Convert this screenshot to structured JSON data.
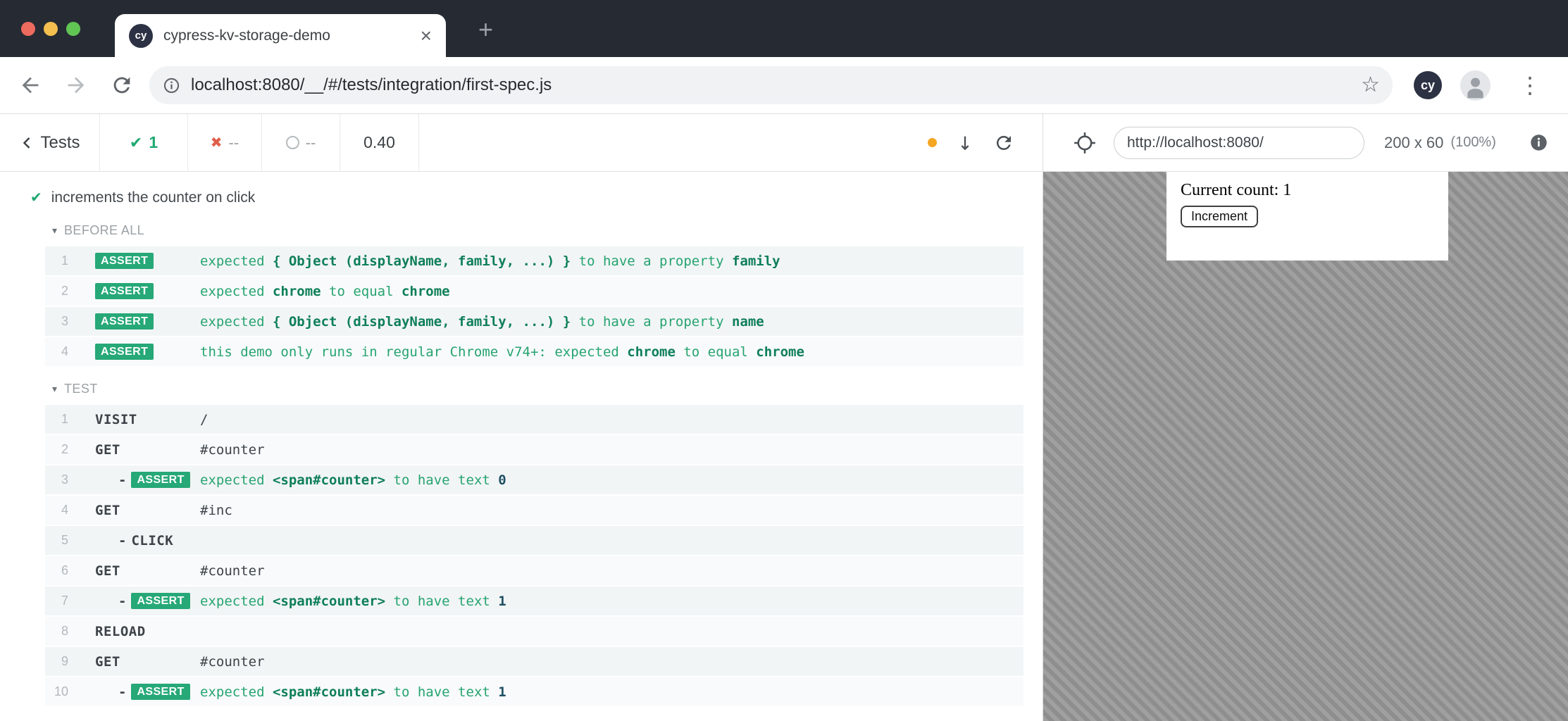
{
  "icons": {
    "check": "✔",
    "cross": "✖",
    "star": "☆",
    "menu_dots": "⋮",
    "close": "×",
    "plus": "+",
    "collapse_caret": "▾",
    "child_dash": "-"
  },
  "titlebar": {
    "tab_title": "cypress-kv-storage-demo",
    "favicon_text": "cy"
  },
  "navbar": {
    "url": "localhost:8080/__/#/tests/integration/first-spec.js",
    "profile_badge": "cy"
  },
  "cy_toolbar": {
    "back_label": "Tests",
    "passed_count": "1",
    "failed_count": "--",
    "pending_count": "--",
    "duration": "0.40",
    "viewport_url": "http://localhost:8080/",
    "viewport_size": "200 x 60",
    "viewport_scale": "(100%)"
  },
  "reporter": {
    "test_title": "increments the counter on click",
    "sections": [
      {
        "label": "BEFORE ALL",
        "rows": [
          {
            "num": "1",
            "badge": "ASSERT",
            "child": false,
            "msg": [
              [
                "expected ",
                "n"
              ],
              [
                "{ Object (displayName, family, ...) }",
                "b"
              ],
              [
                " to have a property ",
                "n"
              ],
              [
                "family",
                "b"
              ]
            ]
          },
          {
            "num": "2",
            "badge": "ASSERT",
            "child": false,
            "msg": [
              [
                "expected ",
                "n"
              ],
              [
                "chrome",
                "b"
              ],
              [
                " to equal ",
                "n"
              ],
              [
                "chrome",
                "b"
              ]
            ]
          },
          {
            "num": "3",
            "badge": "ASSERT",
            "child": false,
            "msg": [
              [
                "expected ",
                "n"
              ],
              [
                "{ Object (displayName, family, ...) }",
                "b"
              ],
              [
                " to have a property ",
                "n"
              ],
              [
                "name",
                "b"
              ]
            ]
          },
          {
            "num": "4",
            "badge": "ASSERT",
            "child": false,
            "msg": [
              [
                "this demo only runs in regular Chrome v74+: expected ",
                "n"
              ],
              [
                "chrome",
                "b"
              ],
              [
                " to equal ",
                "n"
              ],
              [
                "chrome",
                "b"
              ]
            ]
          }
        ]
      },
      {
        "label": "TEST",
        "rows": [
          {
            "num": "1",
            "method": "VISIT",
            "msg": [
              [
                "/",
                "p"
              ]
            ]
          },
          {
            "num": "2",
            "method": "GET",
            "msg": [
              [
                "#counter",
                "p"
              ]
            ]
          },
          {
            "num": "3",
            "badge": "ASSERT",
            "child": true,
            "msg": [
              [
                "expected ",
                "n"
              ],
              [
                "<span#counter>",
                "b"
              ],
              [
                " to have text ",
                "n"
              ],
              [
                "0",
                "v"
              ]
            ]
          },
          {
            "num": "4",
            "method": "GET",
            "msg": [
              [
                "#inc",
                "p"
              ]
            ]
          },
          {
            "num": "5",
            "method": "CLICK",
            "child": true,
            "msg": []
          },
          {
            "num": "6",
            "method": "GET",
            "msg": [
              [
                "#counter",
                "p"
              ]
            ]
          },
          {
            "num": "7",
            "badge": "ASSERT",
            "child": true,
            "msg": [
              [
                "expected ",
                "n"
              ],
              [
                "<span#counter>",
                "b"
              ],
              [
                " to have text ",
                "n"
              ],
              [
                "1",
                "v"
              ]
            ]
          },
          {
            "num": "8",
            "method": "RELOAD",
            "msg": []
          },
          {
            "num": "9",
            "method": "GET",
            "msg": [
              [
                "#counter",
                "p"
              ]
            ]
          },
          {
            "num": "10",
            "badge": "ASSERT",
            "child": true,
            "msg": [
              [
                "expected ",
                "n"
              ],
              [
                "<span#counter>",
                "b"
              ],
              [
                " to have text ",
                "n"
              ],
              [
                "1",
                "v"
              ]
            ]
          }
        ]
      }
    ]
  },
  "aut": {
    "count_text": "Current count: 1",
    "increment_label": "Increment"
  },
  "colors": {
    "pass_green": "#1fa971",
    "fail_red": "#de5f4b",
    "badge_green": "#26a877",
    "accent_orange": "#f5a623",
    "frame_dark": "#262b33"
  }
}
